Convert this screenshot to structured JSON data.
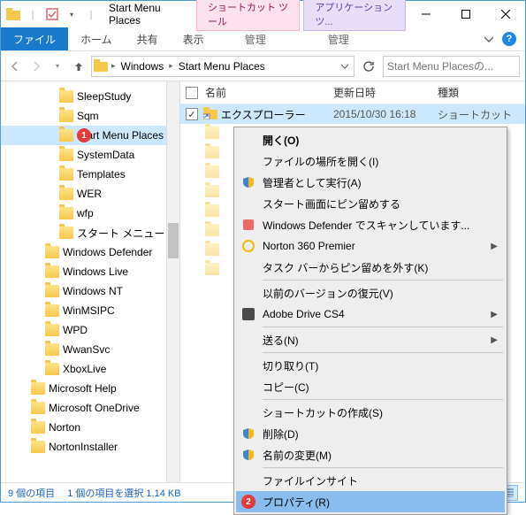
{
  "window": {
    "title": "Start Menu Places",
    "contextual_tabs": {
      "shortcut": "ショートカット ツール",
      "app": "アプリケーション ツ..."
    }
  },
  "ribbon": {
    "file": "ファイル",
    "home": "ホーム",
    "share": "共有",
    "view": "表示",
    "manage1": "管理",
    "manage2": "管理"
  },
  "breadcrumb": {
    "seg1": "Windows",
    "seg2": "Start Menu Places"
  },
  "search": {
    "placeholder": "Start Menu Placesの..."
  },
  "tree": {
    "items": [
      {
        "label": "SleepStudy",
        "lvl": 2
      },
      {
        "label": "Sqm",
        "lvl": 2
      },
      {
        "label": "Start Menu Places",
        "lvl": 2,
        "selected": true,
        "badge": "1"
      },
      {
        "label": "SystemData",
        "lvl": 2
      },
      {
        "label": "Templates",
        "lvl": 2
      },
      {
        "label": "WER",
        "lvl": 2
      },
      {
        "label": "wfp",
        "lvl": 2
      },
      {
        "label": "スタート メニュー",
        "lvl": 2
      },
      {
        "label": "Windows Defender",
        "lvl": 1
      },
      {
        "label": "Windows Live",
        "lvl": 1
      },
      {
        "label": "Windows NT",
        "lvl": 1
      },
      {
        "label": "WinMSIPC",
        "lvl": 1
      },
      {
        "label": "WPD",
        "lvl": 1
      },
      {
        "label": "WwanSvc",
        "lvl": 1
      },
      {
        "label": "XboxLive",
        "lvl": 1
      },
      {
        "label": "Microsoft Help",
        "lvl": 0
      },
      {
        "label": "Microsoft OneDrive",
        "lvl": 0
      },
      {
        "label": "Norton",
        "lvl": 0
      },
      {
        "label": "NortonInstaller",
        "lvl": 0
      }
    ]
  },
  "columns": {
    "name": "名前",
    "date": "更新日時",
    "type": "種類"
  },
  "rows": {
    "selected": {
      "name": "エクスプローラー",
      "date": "2015/10/30 16:18",
      "type": "ショートカット"
    }
  },
  "ctx": {
    "open": "開く(O)",
    "openloc": "ファイルの場所を開く(I)",
    "runas": "管理者として実行(A)",
    "pinstart": "スタート画面にピン留めする",
    "defender": "Windows Defender でスキャンしています...",
    "norton": "Norton 360 Premier",
    "unpintask": "タスク バーからピン留めを外す(K)",
    "prevver": "以前のバージョンの復元(V)",
    "adobe": "Adobe Drive CS4",
    "sendto": "送る(N)",
    "cut": "切り取り(T)",
    "copy": "コピー(C)",
    "makeshortcut": "ショートカットの作成(S)",
    "delete": "削除(D)",
    "rename": "名前の変更(M)",
    "fileinsight": "ファイルインサイト",
    "properties": "プロパティ(R)"
  },
  "status": {
    "count": "9 個の項目",
    "sel": "1 個の項目を選択 1.14 KB"
  }
}
